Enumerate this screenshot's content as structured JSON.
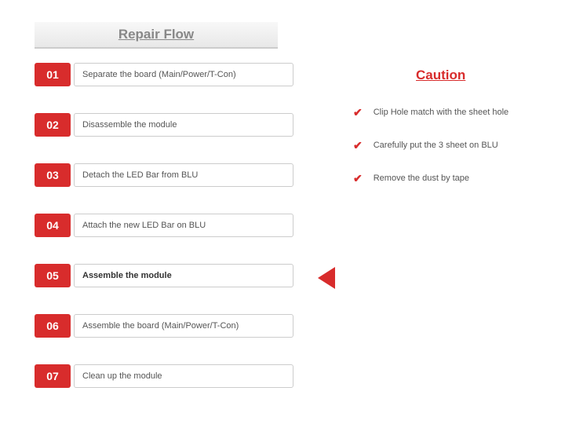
{
  "title": "Repair Flow",
  "active_step_index": 4,
  "steps": [
    {
      "num": "01",
      "text": "Separate the board (Main/Power/T-Con)"
    },
    {
      "num": "02",
      "text": "Disassemble the module"
    },
    {
      "num": "03",
      "text": "Detach the LED Bar from BLU"
    },
    {
      "num": "04",
      "text": "Attach the new LED Bar on BLU"
    },
    {
      "num": "05",
      "text": "Assemble the module"
    },
    {
      "num": "06",
      "text": "Assemble the board (Main/Power/T-Con)"
    },
    {
      "num": "07",
      "text": "Clean up the module"
    }
  ],
  "caution_title": "Caution",
  "cautions": [
    "Clip Hole match with the sheet hole",
    "Carefully put the 3 sheet on BLU",
    "Remove the dust by tape"
  ]
}
